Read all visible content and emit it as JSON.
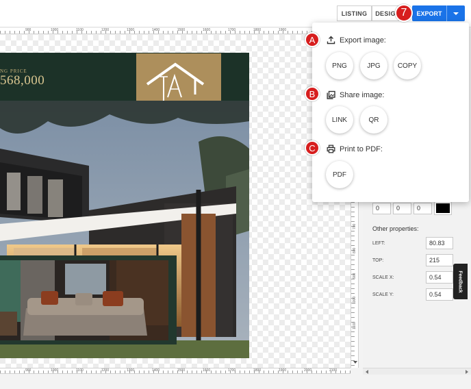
{
  "topbar": {
    "tab_listing": "LISTING",
    "tab_design": "DESIG",
    "export_label": "EXPORT",
    "step_marker": "7"
  },
  "ruler_top": [
    "900",
    "1000",
    "1100",
    "1200",
    "1300",
    "1400",
    "1500",
    "1600",
    "1700",
    "1800",
    "1900"
  ],
  "ruler_bottom": [
    "900",
    "1000",
    "1100",
    "1200",
    "1300",
    "1400",
    "1500",
    "1600",
    "1700",
    "1800",
    "1900",
    "2000",
    "2100"
  ],
  "ruler_side": [
    "700",
    "800",
    "900",
    "1000",
    "1100"
  ],
  "flyer": {
    "price_label": "NG PRICE",
    "price_value": "568,000",
    "logo_text": "JA"
  },
  "export_menu": {
    "export_image": {
      "marker": "A",
      "title": "Export image:",
      "icon": "upload-icon",
      "buttons": [
        "PNG",
        "JPG",
        "COPY"
      ]
    },
    "share_image": {
      "marker": "B",
      "title": "Share image:",
      "icon": "image-library-icon",
      "buttons": [
        "LINK",
        "QR"
      ]
    },
    "print_pdf": {
      "marker": "C",
      "title": "Print to PDF:",
      "icon": "printer-icon",
      "buttons": [
        "PDF"
      ]
    }
  },
  "properties": {
    "rgb": [
      "0",
      "0",
      "0"
    ],
    "color": "#000000",
    "other_title": "Other properties:",
    "left_label": "LEFT:",
    "left_value": "80.83",
    "top_label": "TOP:",
    "top_value": "215",
    "scale_x_label": "SCALE X:",
    "scale_x_value": "0.54",
    "scale_y_label": "SCALE Y:",
    "scale_y_value": "0.54"
  },
  "feedback_label": "Feedback",
  "colors": {
    "accent": "#1a73e8",
    "marker_red": "#d71e1e",
    "flyer_green": "#1c3228",
    "logo_gold": "#ad8f5c"
  }
}
